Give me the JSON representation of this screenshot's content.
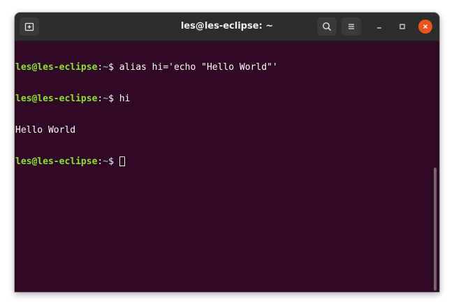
{
  "window": {
    "title": "les@les-eclipse: ~",
    "background": "#300a24",
    "titlebar_color": "#2d2d2d",
    "close_color": "#e95420"
  },
  "titlebar": {
    "new_tab_icon": "new-tab-icon",
    "search_icon": "search-icon",
    "menu_icon": "hamburger-menu-icon",
    "minimize_icon": "minimize-icon",
    "maximize_icon": "maximize-icon",
    "close_icon": "close-icon"
  },
  "terminal": {
    "prompt_user": "les@les-eclipse",
    "prompt_sep": ":",
    "prompt_path": "~",
    "prompt_dollar": "$ ",
    "lines": [
      {
        "type": "prompt",
        "command": "alias hi='echo \"Hello World\"'"
      },
      {
        "type": "prompt",
        "command": "hi"
      },
      {
        "type": "output",
        "text": "Hello World"
      },
      {
        "type": "prompt",
        "command": ""
      }
    ],
    "user_color": "#8ae234",
    "path_color": "#729fcf"
  }
}
